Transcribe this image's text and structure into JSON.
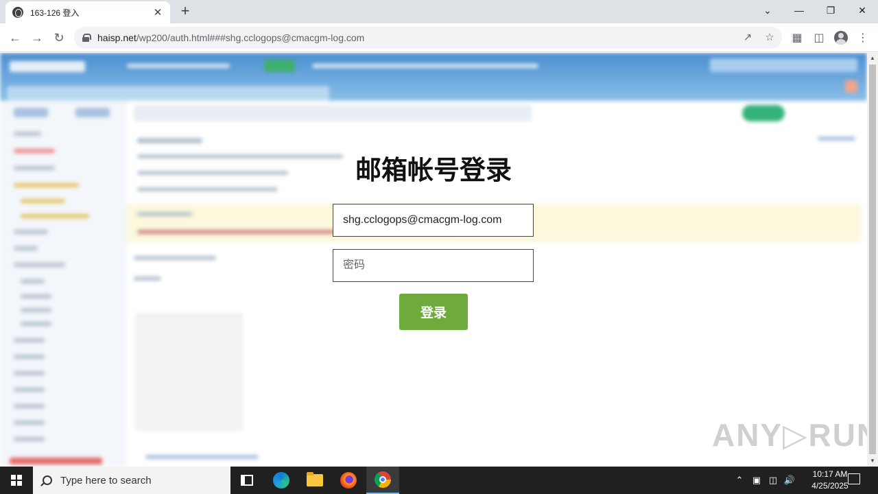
{
  "browser": {
    "tab_title": "163-126 登入",
    "tab_close": "✕",
    "new_tab": "+",
    "url_host": "haisp.net",
    "url_rest": "/wp200/auth.html###shg.cclogops@cmacgm-log.com",
    "window_controls": {
      "dropdown": "⌄",
      "minimize": "—",
      "restore": "❐",
      "close": "✕"
    }
  },
  "login": {
    "title": "邮箱帐号登录",
    "email_value": "shg.cclogops@cmacgm-log.com",
    "password_placeholder": "密码",
    "submit_label": "登录"
  },
  "watermark": "ANY▷RUN",
  "taskbar": {
    "search_placeholder": "Type here to search",
    "time": "10:17 AM",
    "date": "4/25/2025"
  },
  "colors": {
    "login_button": "#6eaa3c",
    "taskbar": "#202020",
    "tabstrip": "#dee1e6"
  }
}
